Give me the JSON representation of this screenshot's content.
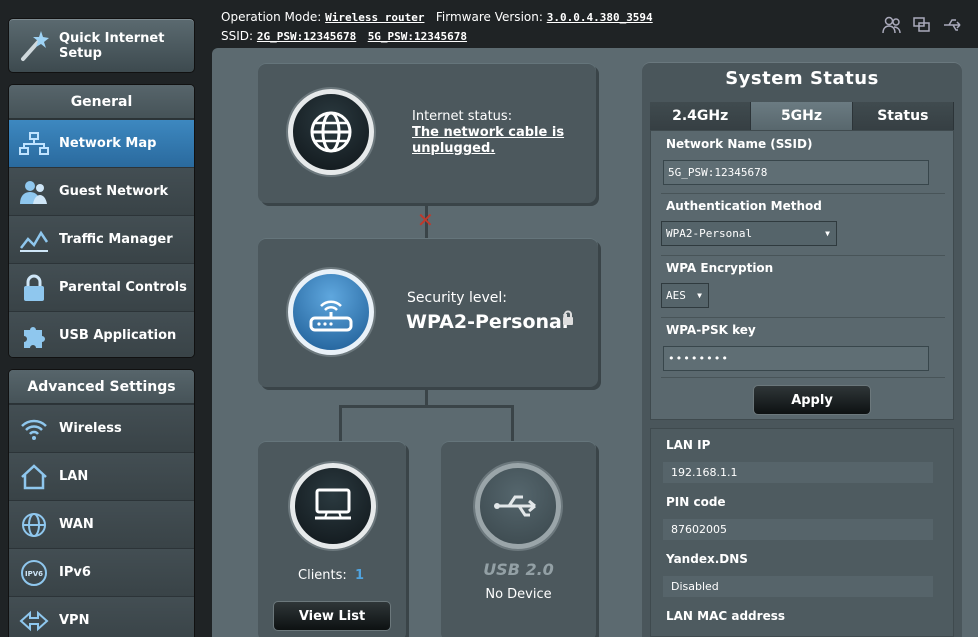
{
  "topbar": {
    "operation_mode_label": "Operation Mode:",
    "operation_mode_value": "Wireless router",
    "firmware_label": "Firmware Version:",
    "firmware_value": "3.0.0.4.380_3594",
    "ssid_label": "SSID:",
    "ssid_2g": "2G_PSW:12345678",
    "ssid_5g": "5G_PSW:12345678",
    "icons": [
      "users-icon",
      "copy-icon",
      "usb-icon"
    ]
  },
  "sidebar": {
    "quick_setup_label_line1": "Quick Internet",
    "quick_setup_label_line2": "Setup",
    "general_title": "General",
    "general_items": [
      {
        "label": "Network Map",
        "icon": "network-map-icon",
        "active": true
      },
      {
        "label": "Guest Network",
        "icon": "guest-network-icon"
      },
      {
        "label": "Traffic Manager",
        "icon": "traffic-manager-icon"
      },
      {
        "label": "Parental Controls",
        "icon": "parental-controls-icon"
      },
      {
        "label": "USB Application",
        "icon": "usb-application-icon"
      }
    ],
    "advanced_title": "Advanced Settings",
    "advanced_items": [
      {
        "label": "Wireless",
        "icon": "wireless-icon"
      },
      {
        "label": "LAN",
        "icon": "lan-icon"
      },
      {
        "label": "WAN",
        "icon": "wan-icon"
      },
      {
        "label": "IPv6",
        "icon": "ipv6-icon"
      },
      {
        "label": "VPN",
        "icon": "vpn-icon"
      }
    ]
  },
  "network_map": {
    "internet_status_label": "Internet status:",
    "internet_status_line1": "The network cable is",
    "internet_status_line2": "unplugged.",
    "security_label": "Security level:",
    "security_value": "WPA2-Personal",
    "clients_label": "Clients:",
    "clients_count": "1",
    "view_list_button": "View List",
    "usb_label": "USB 2.0",
    "usb_status": "No Device"
  },
  "system_status": {
    "title": "System Status",
    "tabs": [
      "2.4GHz",
      "5GHz",
      "Status"
    ],
    "active_tab": "5GHz",
    "ssid_label": "Network Name (SSID)",
    "ssid_value": "5G_PSW:12345678",
    "auth_label": "Authentication Method",
    "auth_value": "WPA2-Personal",
    "enc_label": "WPA Encryption",
    "enc_value": "AES",
    "psk_label": "WPA-PSK key",
    "psk_value": "••••••••",
    "apply_button": "Apply",
    "lan_ip_label": "LAN IP",
    "lan_ip_value": "192.168.1.1",
    "pin_label": "PIN code",
    "pin_value": "87602005",
    "dns_label": "Yandex.DNS",
    "dns_value": "Disabled",
    "mac_label": "LAN MAC address"
  },
  "colors": {
    "accent_blue": "#2f77b0",
    "page_bg": "#1f2325",
    "panel_bg": "#5c6a70",
    "disconnect_red": "#c0392b"
  }
}
